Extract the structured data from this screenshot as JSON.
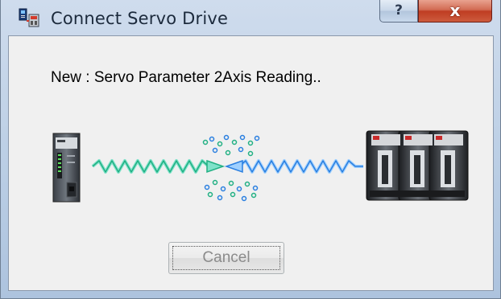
{
  "window": {
    "title": "Connect Servo Drive",
    "help_label": "?",
    "close_label": "x"
  },
  "status": {
    "message": "New : Servo Parameter 2Axis Reading.."
  },
  "buttons": {
    "cancel_label": "Cancel"
  },
  "icons": {
    "app": "connect-drive-icon",
    "controller": "plc-controller-icon",
    "drives": "servo-drives-icon",
    "signal": "transfer-wave-icon"
  },
  "colors": {
    "tx_wave": "#3cc7a3",
    "rx_wave": "#3a8fe6",
    "close_button": "#c9482c",
    "client_bg": "#f0f0f0"
  }
}
